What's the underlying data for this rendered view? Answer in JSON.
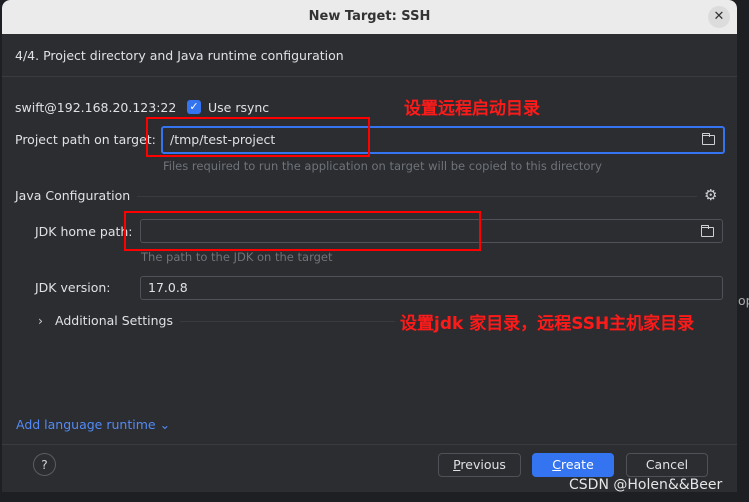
{
  "dialog": {
    "title": "New Target: SSH",
    "step": "4/4. Project directory and Java runtime configuration"
  },
  "connection": {
    "host": "swift@192.168.20.123:22",
    "use_rsync_label": "Use rsync",
    "use_rsync_checked": true
  },
  "project_path": {
    "label": "Project path on target:",
    "value": "/tmp/test-project",
    "hint": "Files required to run the application on target will be copied to this directory"
  },
  "java": {
    "section_title": "Java Configuration",
    "jdk_home_label": "JDK home path:",
    "jdk_home_value": "",
    "jdk_home_hint": "The path to the JDK on the target",
    "jdk_version_label": "JDK version:",
    "jdk_version_value": "17.0.8",
    "additional_settings": "Additional Settings"
  },
  "add_runtime": "Add language runtime",
  "buttons": {
    "help": "?",
    "previous_first": "P",
    "previous_rest": "revious",
    "create_first": "C",
    "create_rest": "reate",
    "cancel": "Cancel"
  },
  "annotations": {
    "project": "设置远程启动目录",
    "jdk": "设置jdk 家目录，远程SSH主机家目录"
  },
  "background_fragment": "op",
  "watermark": "CSDN @Holen&&Beer",
  "colors": {
    "accent": "#3574f0",
    "annotation": "#ff0000",
    "dialog_bg": "#2b2d30"
  }
}
